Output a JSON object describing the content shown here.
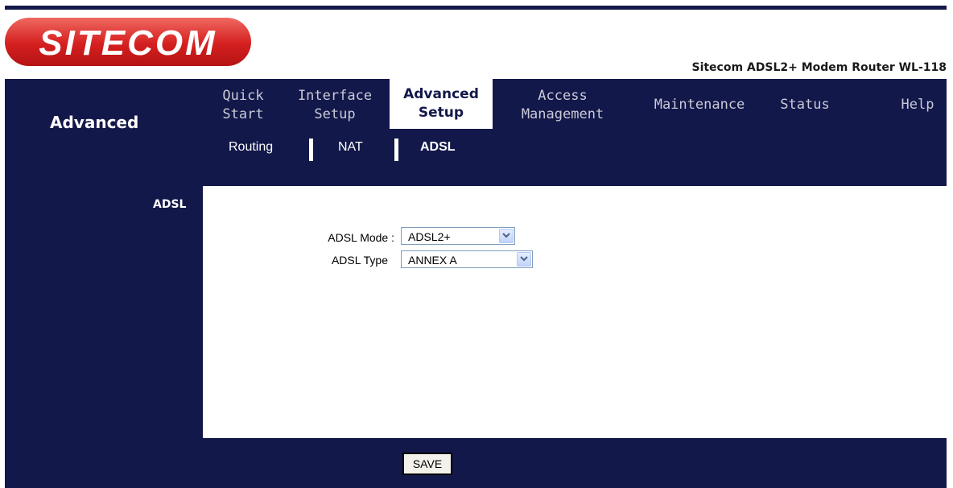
{
  "brand": {
    "logo_text": "SITECOM",
    "model_name": "Sitecom ADSL2+ Modem Router WL-118"
  },
  "sidebar": {
    "title": "Advanced",
    "section": "ADSL"
  },
  "nav": {
    "tabs": [
      {
        "line1": "Quick",
        "line2": "Start"
      },
      {
        "line1": "Interface",
        "line2": "Setup"
      },
      {
        "line1": "Advanced",
        "line2": "Setup",
        "active": true
      },
      {
        "line1": "Access",
        "line2": "Management"
      },
      {
        "line1": "Maintenance",
        "line2": ""
      },
      {
        "line1": "Status",
        "line2": ""
      },
      {
        "line1": "Help",
        "line2": ""
      }
    ],
    "subtabs": [
      {
        "label": "Routing"
      },
      {
        "label": "NAT"
      },
      {
        "label": "ADSL",
        "active": true
      }
    ]
  },
  "form": {
    "adsl_mode": {
      "label": "ADSL Mode :",
      "value": "ADSL2+"
    },
    "adsl_type": {
      "label": "ADSL Type",
      "value": "ANNEX A"
    }
  },
  "footer": {
    "save_label": "SAVE"
  },
  "colors": {
    "navy": "#13184a",
    "logo_red": "#d41f1f",
    "tab_text": "#c9cad6"
  },
  "icons": {
    "select_arrow": "chevron-down-icon"
  }
}
